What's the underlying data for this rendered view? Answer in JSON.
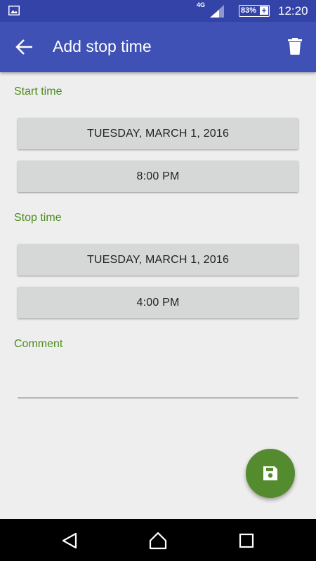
{
  "status_bar": {
    "network": "4G",
    "battery": "83%",
    "battery_charging": "+",
    "clock": "12:20"
  },
  "app_bar": {
    "title": "Add stop time"
  },
  "start": {
    "label": "Start time",
    "date": "TUESDAY, MARCH 1, 2016",
    "time": "8:00 PM"
  },
  "stop": {
    "label": "Stop time",
    "date": "TUESDAY, MARCH 1, 2016",
    "time": "4:00 PM"
  },
  "comment": {
    "label": "Comment",
    "value": ""
  },
  "icons": {
    "status": [
      "gallery-icon",
      "signal-icon",
      "battery-icon"
    ],
    "app_bar": [
      "back-arrow-icon",
      "delete-icon"
    ],
    "fab": "save-icon",
    "nav": [
      "back-triangle-icon",
      "home-icon",
      "recents-icon"
    ]
  },
  "colors": {
    "primary": "#3f51b5",
    "primary_dark": "#3443a8",
    "accent": "#558b2f",
    "label_green": "#4e8c1d",
    "button_bg": "#d6d7d7",
    "background": "#eeeeee"
  }
}
